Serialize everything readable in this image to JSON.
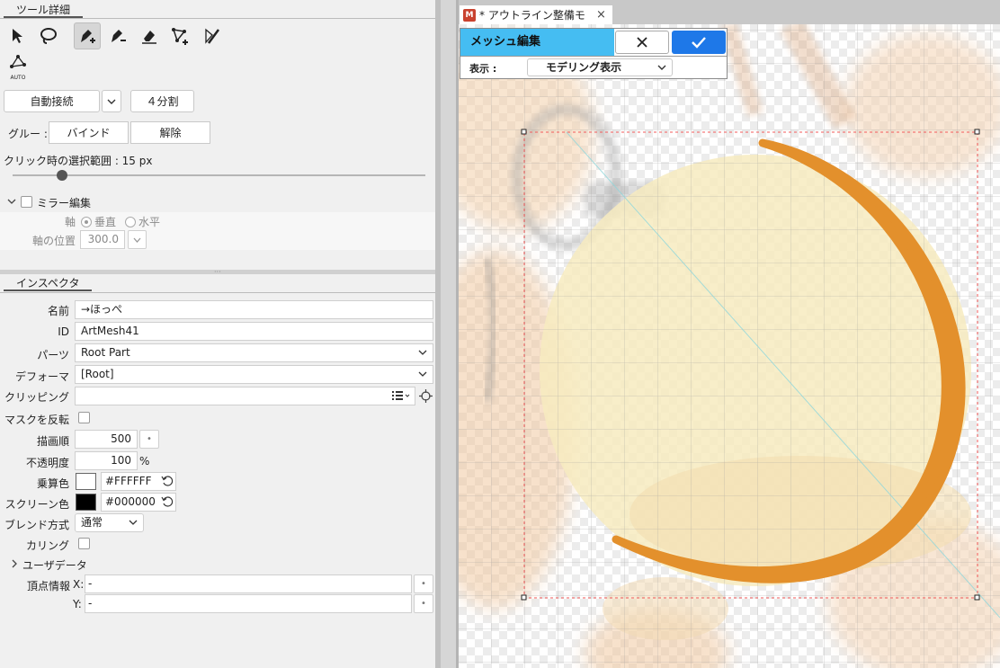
{
  "tool_detail": {
    "title": "ツール詳細",
    "auto_label": "AUTO",
    "auto_connect": "自動接続",
    "split": "４分割",
    "glue_label": "グルー :",
    "bind": "バインド",
    "release": "解除",
    "click_range_label": "クリック時の選択範囲 : 15 px",
    "click_range_value": 15,
    "click_range_fraction": 0.12,
    "mirror_label": "ミラー編集",
    "axis_label": "軸",
    "axis_vertical": "垂直",
    "axis_horizontal": "水平",
    "axis_pos_label": "軸の位置",
    "axis_pos_value": "300.0"
  },
  "inspector": {
    "title": "インスペクタ",
    "name_label": "名前",
    "name_value": "→ほっぺ",
    "id_label": "ID",
    "id_value": "ArtMesh41",
    "parts_label": "パーツ",
    "parts_value": "Root Part",
    "deformer_label": "デフォーマ",
    "deformer_value": "[Root]",
    "clipping_label": "クリッピング",
    "clipping_value": "",
    "mask_invert_label": "マスクを反転",
    "draw_order_label": "描画順",
    "draw_order_value": "500",
    "opacity_label": "不透明度",
    "opacity_value": "100",
    "opacity_unit": "%",
    "multiply_label": "乗算色",
    "multiply_value": "#FFFFFF",
    "screen_label": "スクリーン色",
    "screen_value": "#000000",
    "blend_label": "ブレンド方式",
    "blend_value": "通常",
    "culling_label": "カリング",
    "userdata_label": "ユーザデータ",
    "vertex_label": "頂点情報",
    "x_label": "X:",
    "x_value": "-",
    "y_label": "Y:",
    "y_value": "-"
  },
  "document": {
    "tab_title": "* アウトライン整備モ",
    "mesh_edit_title": "メッシュ編集",
    "display_label": "表示 :",
    "display_value": "モデリング表示"
  },
  "colors": {
    "accent": "#45bdf2",
    "confirm": "#1e78e8",
    "stroke": "#e3902c"
  }
}
